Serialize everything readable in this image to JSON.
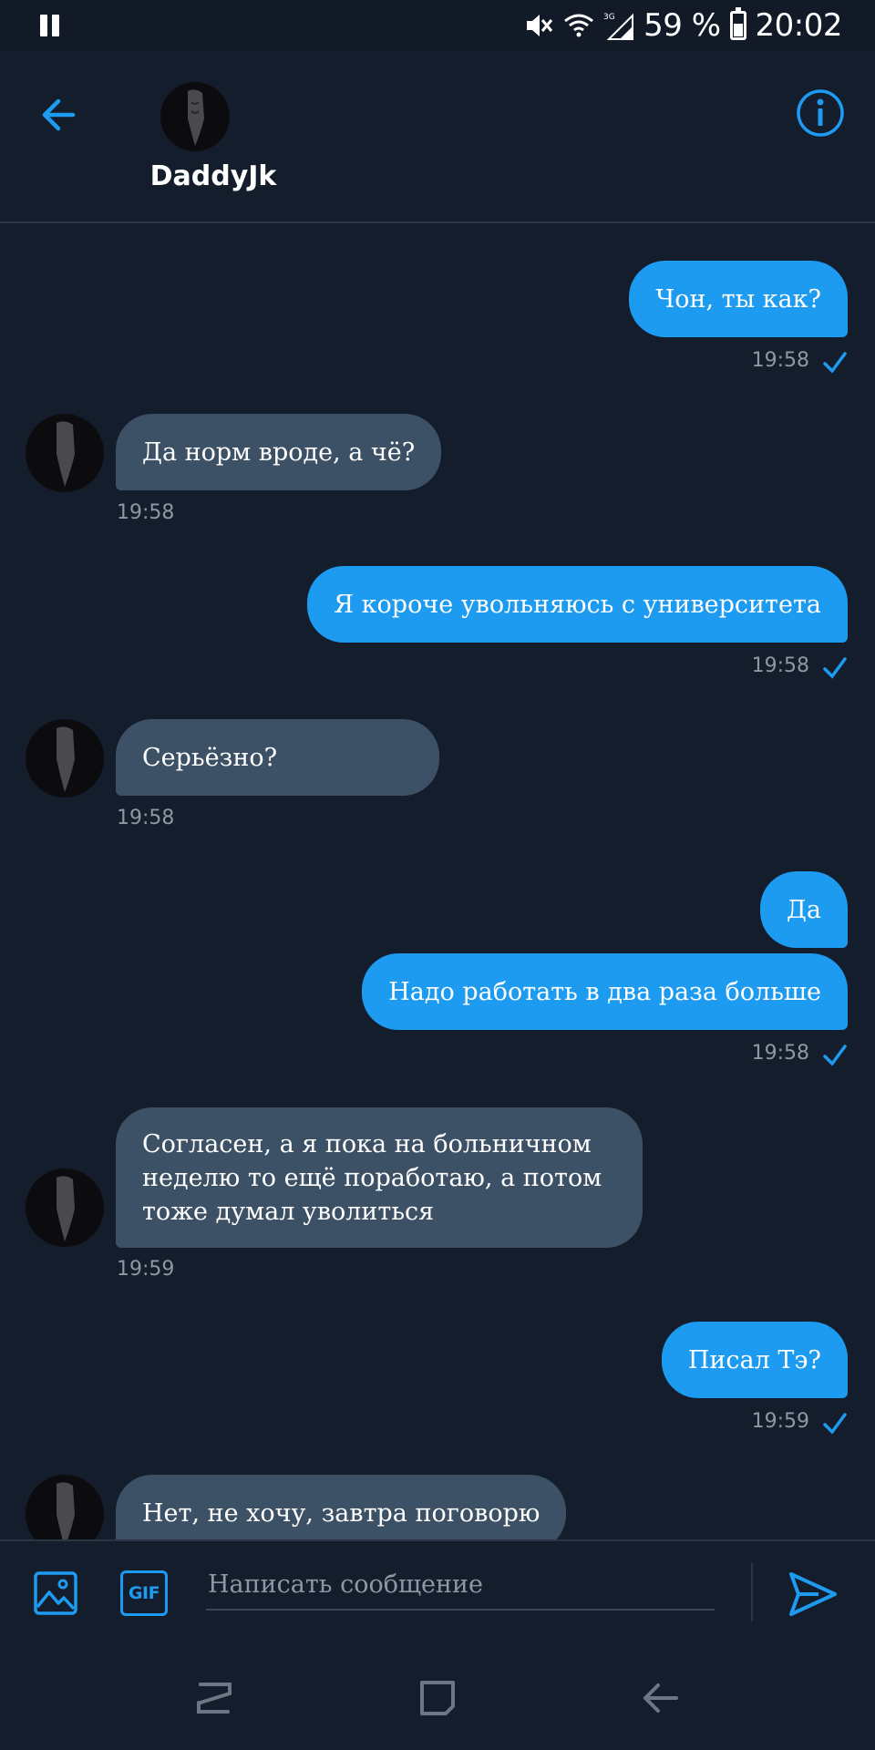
{
  "status_bar": {
    "battery_percent": "59 %",
    "time": "20:02",
    "network_label": "3G"
  },
  "header": {
    "contact_name": "DaddyJk"
  },
  "messages": [
    {
      "direction": "out",
      "text": "Чон, ты как?",
      "time": "19:58",
      "status": "sent"
    },
    {
      "direction": "in",
      "text": "Да норм вроде, а чё?",
      "time": "19:58"
    },
    {
      "direction": "out",
      "text": "Я короче увольняюсь с университета",
      "time": "19:58",
      "status": "sent"
    },
    {
      "direction": "in",
      "text": "Серьёзно?",
      "time": "19:58"
    },
    {
      "direction": "out",
      "text": "Да",
      "time": ""
    },
    {
      "direction": "out",
      "text": "Надо работать в два раза больше",
      "time": "19:58",
      "status": "sent"
    },
    {
      "direction": "in",
      "text": "Согласен, а я пока на больничном неделю то ещё поработаю, а потом тоже думал уволиться",
      "time": "19:59"
    },
    {
      "direction": "out",
      "text": "Писал Тэ?",
      "time": "19:59",
      "status": "sent"
    },
    {
      "direction": "in",
      "text": "Нет, не хочу, завтра поговорю",
      "time": ""
    }
  ],
  "composer": {
    "placeholder": "Написать сообщение",
    "gif_label": "GIF"
  },
  "icons": {
    "back": "arrow-left-icon",
    "info": "info-icon",
    "image": "image-icon",
    "send": "send-icon",
    "checkmark": "check-icon"
  },
  "colors": {
    "background": "#141d2b",
    "accent": "#1d9bf0",
    "incoming_bubble": "#3d5166",
    "timestamp": "#8b98a5"
  }
}
